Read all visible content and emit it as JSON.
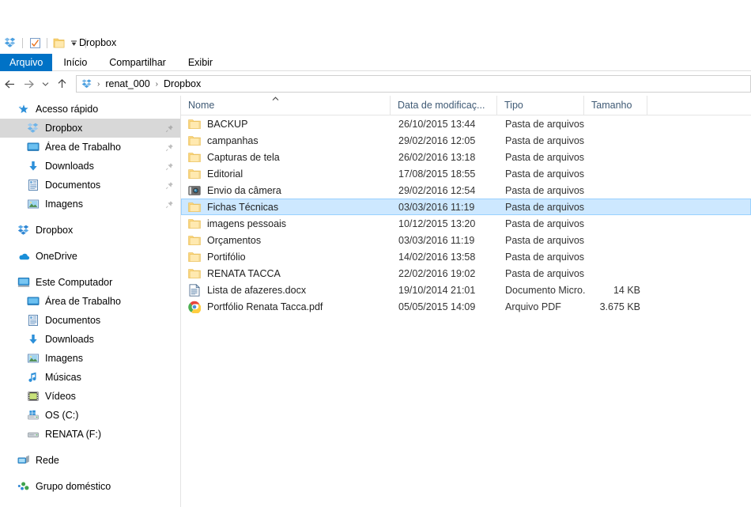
{
  "window": {
    "title": "Dropbox",
    "quick_access_icons": [
      "dropbox-icon",
      "properties-icon",
      "new-folder-icon",
      "customize-chevron-icon"
    ]
  },
  "ribbon": {
    "tabs": [
      {
        "label": "Arquivo",
        "active": true
      },
      {
        "label": "Início",
        "active": false
      },
      {
        "label": "Compartilhar",
        "active": false
      },
      {
        "label": "Exibir",
        "active": false
      }
    ]
  },
  "addressbar": {
    "back_icon": "arrow-left-icon",
    "forward_icon": "arrow-right-icon",
    "recent_icon": "chevron-down-icon",
    "up_icon": "arrow-up-icon",
    "crumb_icon": "dropbox-icon",
    "crumbs": [
      "renat_000",
      "Dropbox"
    ],
    "separator": "›"
  },
  "sidebar": {
    "groups": [
      {
        "items": [
          {
            "label": "Acesso rápido",
            "icon": "quick-access-star-icon",
            "level": 0,
            "pinned": false,
            "active": false
          },
          {
            "label": "Dropbox",
            "icon": "dropbox-icon",
            "level": 1,
            "pinned": true,
            "active": true
          },
          {
            "label": "Área de Trabalho",
            "icon": "desktop-icon",
            "level": 1,
            "pinned": true,
            "active": false
          },
          {
            "label": "Downloads",
            "icon": "downloads-arrow-icon",
            "level": 1,
            "pinned": true,
            "active": false
          },
          {
            "label": "Documentos",
            "icon": "documents-icon",
            "level": 1,
            "pinned": true,
            "active": false
          },
          {
            "label": "Imagens",
            "icon": "pictures-icon",
            "level": 1,
            "pinned": true,
            "active": false
          }
        ]
      },
      {
        "items": [
          {
            "label": "Dropbox",
            "icon": "dropbox-icon",
            "level": 0,
            "pinned": false,
            "active": false
          }
        ]
      },
      {
        "items": [
          {
            "label": "OneDrive",
            "icon": "onedrive-cloud-icon",
            "level": 0,
            "pinned": false,
            "active": false
          }
        ]
      },
      {
        "items": [
          {
            "label": "Este Computador",
            "icon": "this-pc-icon",
            "level": 0,
            "pinned": false,
            "active": false
          },
          {
            "label": "Área de Trabalho",
            "icon": "desktop-icon",
            "level": 1,
            "pinned": false,
            "active": false
          },
          {
            "label": "Documentos",
            "icon": "documents-icon",
            "level": 1,
            "pinned": false,
            "active": false
          },
          {
            "label": "Downloads",
            "icon": "downloads-arrow-icon",
            "level": 1,
            "pinned": false,
            "active": false
          },
          {
            "label": "Imagens",
            "icon": "pictures-icon",
            "level": 1,
            "pinned": false,
            "active": false
          },
          {
            "label": "Músicas",
            "icon": "music-note-icon",
            "level": 1,
            "pinned": false,
            "active": false
          },
          {
            "label": "Vídeos",
            "icon": "video-icon",
            "level": 1,
            "pinned": false,
            "active": false
          },
          {
            "label": "OS (C:)",
            "icon": "windows-drive-icon",
            "level": 1,
            "pinned": false,
            "active": false
          },
          {
            "label": "RENATA (F:)",
            "icon": "drive-icon",
            "level": 1,
            "pinned": false,
            "active": false
          }
        ]
      },
      {
        "items": [
          {
            "label": "Rede",
            "icon": "network-icon",
            "level": 0,
            "pinned": false,
            "active": false
          }
        ]
      },
      {
        "items": [
          {
            "label": "Grupo doméstico",
            "icon": "homegroup-icon",
            "level": 0,
            "pinned": false,
            "active": false
          }
        ]
      }
    ]
  },
  "filelist": {
    "columns": [
      {
        "label": "Nome",
        "key": "name",
        "sorted": true,
        "sort_direction": "asc"
      },
      {
        "label": "Data de modificaç...",
        "key": "date",
        "sorted": false
      },
      {
        "label": "Tipo",
        "key": "type",
        "sorted": false
      },
      {
        "label": "Tamanho",
        "key": "size",
        "sorted": false
      }
    ],
    "rows": [
      {
        "name": "BACKUP",
        "date": "26/10/2015 13:44",
        "type": "Pasta de arquivos",
        "size": "",
        "icon": "folder-icon",
        "selected": false
      },
      {
        "name": "campanhas",
        "date": "29/02/2016 12:05",
        "type": "Pasta de arquivos",
        "size": "",
        "icon": "folder-icon",
        "selected": false
      },
      {
        "name": "Capturas de tela",
        "date": "26/02/2016 13:18",
        "type": "Pasta de arquivos",
        "size": "",
        "icon": "folder-icon",
        "selected": false
      },
      {
        "name": "Editorial",
        "date": "17/08/2015 18:55",
        "type": "Pasta de arquivos",
        "size": "",
        "icon": "folder-icon",
        "selected": false
      },
      {
        "name": "Envio da câmera",
        "date": "29/02/2016 12:54",
        "type": "Pasta de arquivos",
        "size": "",
        "icon": "camera-folder-icon",
        "selected": false
      },
      {
        "name": "Fichas Técnicas",
        "date": "03/03/2016 11:19",
        "type": "Pasta de arquivos",
        "size": "",
        "icon": "folder-icon",
        "selected": true
      },
      {
        "name": "imagens pessoais",
        "date": "10/12/2015 13:20",
        "type": "Pasta de arquivos",
        "size": "",
        "icon": "folder-icon",
        "selected": false
      },
      {
        "name": "Orçamentos",
        "date": "03/03/2016 11:19",
        "type": "Pasta de arquivos",
        "size": "",
        "icon": "folder-icon",
        "selected": false
      },
      {
        "name": "Portifólio",
        "date": "14/02/2016 13:58",
        "type": "Pasta de arquivos",
        "size": "",
        "icon": "folder-icon",
        "selected": false
      },
      {
        "name": "RENATA TACCA",
        "date": "22/02/2016 19:02",
        "type": "Pasta de arquivos",
        "size": "",
        "icon": "folder-icon",
        "selected": false
      },
      {
        "name": "Lista de afazeres.docx",
        "date": "19/10/2014 21:01",
        "type": "Documento Micro...",
        "size": "14 KB",
        "icon": "word-document-icon",
        "selected": false
      },
      {
        "name": "Portfólio Renata Tacca.pdf",
        "date": "05/05/2015 14:09",
        "type": "Arquivo PDF",
        "size": "3.675 KB",
        "icon": "chrome-pdf-icon",
        "selected": false
      }
    ]
  },
  "colors": {
    "accent": "#0072c6",
    "selection_fill": "#cde8ff",
    "selection_border": "#99d1ff",
    "folder_yellow": "#ffd675",
    "header_text": "#3f5a75"
  }
}
